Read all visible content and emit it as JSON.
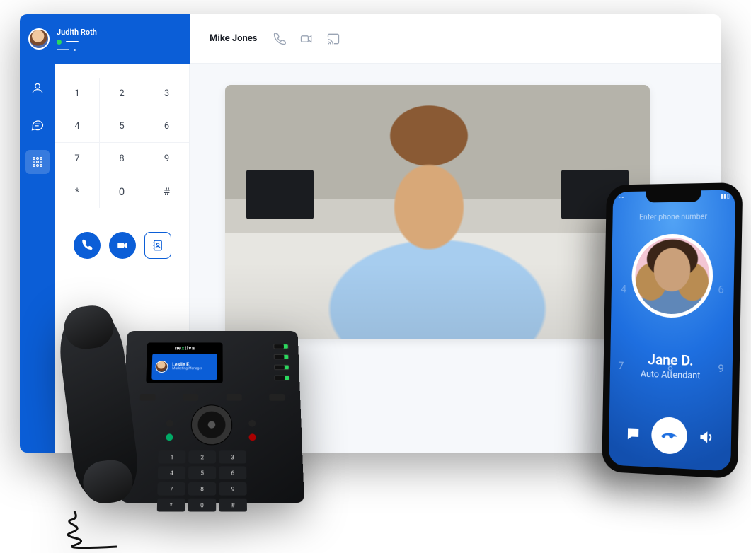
{
  "colors": {
    "primary": "#0b5ed7",
    "online": "#2bd85e"
  },
  "user": {
    "name": "Judith Roth",
    "status": "online"
  },
  "nav": {
    "items": [
      {
        "id": "contacts",
        "icon": "person-icon",
        "active": false
      },
      {
        "id": "chat",
        "icon": "chat-icon",
        "active": false
      },
      {
        "id": "dialpad",
        "icon": "grid-icon",
        "active": true
      }
    ]
  },
  "dialpad": {
    "keys": [
      "1",
      "2",
      "3",
      "4",
      "5",
      "6",
      "7",
      "8",
      "9",
      "*",
      "0",
      "#"
    ],
    "actions": {
      "call": "call",
      "video": "video",
      "contacts": "contacts"
    }
  },
  "header": {
    "contact_name": "Mike Jones",
    "icons": [
      "phone-icon",
      "video-icon",
      "cast-icon"
    ]
  },
  "desk_phone": {
    "brand": "nextiva",
    "screen_contact": {
      "name": "Leslie E.",
      "role": "Marketing Manager"
    },
    "keys": [
      "1",
      "2",
      "3",
      "4",
      "5",
      "6",
      "7",
      "8",
      "9",
      "*",
      "0",
      "#"
    ]
  },
  "mobile": {
    "input_hint": "Enter phone number",
    "faint_keys_mid": [
      "4",
      "",
      "6"
    ],
    "faint_keys_low": [
      "7",
      "8",
      "9"
    ],
    "caller_name": "Jane D.",
    "caller_role": "Auto Attendant",
    "controls": [
      "chat-icon",
      "hangup-icon",
      "speaker-icon"
    ]
  }
}
